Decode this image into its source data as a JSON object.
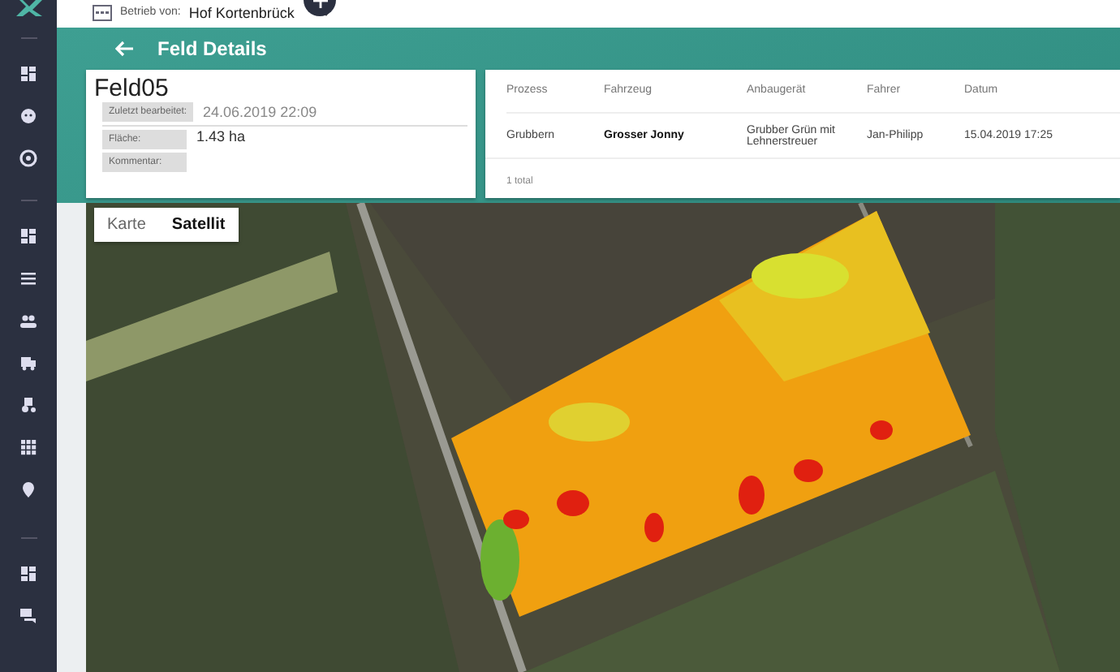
{
  "top_bar": {
    "farm_label": "Betrieb von:",
    "farm_name": "Hof Kortenbrück"
  },
  "header": {
    "title": "Feld Details"
  },
  "field": {
    "name": "Feld05",
    "edited_label": "Zuletzt bearbeitet:",
    "edited_value": "24.06.2019 22:09",
    "properties": [
      {
        "label": "Fläche:",
        "value": "1.43 ha"
      },
      {
        "label": "Kommentar:"
      }
    ]
  },
  "table": {
    "columns": [
      {
        "label": "Prozess",
        "bold": false
      },
      {
        "label": "Fahrzeug",
        "bold": true
      },
      {
        "label": "Anbaugerät",
        "bold": false
      },
      {
        "label": "Fahrer",
        "bold": false
      },
      {
        "label": "Datum",
        "bold": false
      }
    ],
    "rows": [
      [
        "Grubbern",
        "Grosser Jonny",
        "Grubber Grün mit Lehnerstreuer",
        "Jan-Philipp",
        "15.04.2019 17:25"
      ]
    ],
    "footer": "1 total"
  },
  "map": {
    "tabs": [
      {
        "label": "Karte",
        "selected": false
      },
      {
        "label": "Satellit",
        "selected": true
      }
    ]
  }
}
